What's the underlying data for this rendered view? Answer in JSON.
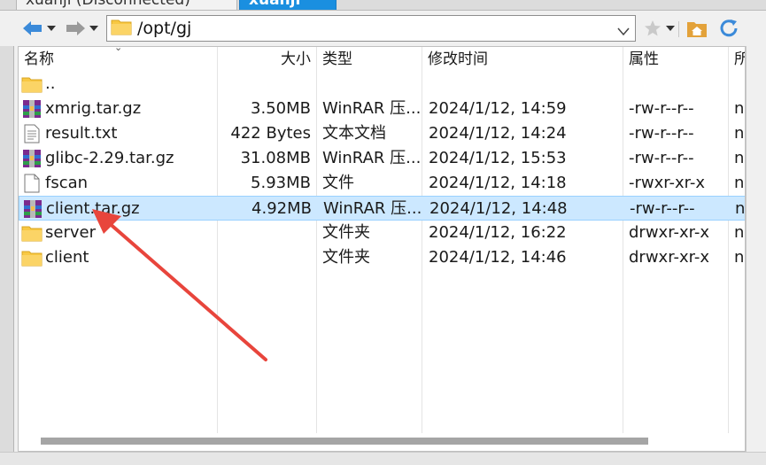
{
  "tabs": [
    {
      "label": "xuanji (Disconnected)",
      "active": false
    },
    {
      "label": "xuanji",
      "active": true
    }
  ],
  "toolbar": {
    "path": "/opt/gj"
  },
  "columns": {
    "name": "名称",
    "size": "大小",
    "type": "类型",
    "modified": "修改时间",
    "permissions": "属性",
    "owner": "所"
  },
  "files": [
    {
      "name": "..",
      "size": "",
      "type": "",
      "modified": "",
      "permissions": "",
      "owner": "",
      "icon": "folder-up-icon",
      "selected": false
    },
    {
      "name": "xmrig.tar.gz",
      "size": "3.50MB",
      "type": "WinRAR 压...",
      "modified": "2024/1/12, 14:59",
      "permissions": "-rw-r--r--",
      "owner": "n",
      "icon": "winrar-archive-icon",
      "selected": false
    },
    {
      "name": "result.txt",
      "size": "422 Bytes",
      "type": "文本文档",
      "modified": "2024/1/12, 14:24",
      "permissions": "-rw-r--r--",
      "owner": "n",
      "icon": "text-file-icon",
      "selected": false
    },
    {
      "name": "glibc-2.29.tar.gz",
      "size": "31.08MB",
      "type": "WinRAR 压...",
      "modified": "2024/1/12, 15:53",
      "permissions": "-rw-r--r--",
      "owner": "n",
      "icon": "winrar-archive-icon",
      "selected": false
    },
    {
      "name": "fscan",
      "size": "5.93MB",
      "type": "文件",
      "modified": "2024/1/12, 14:18",
      "permissions": "-rwxr-xr-x",
      "owner": "n",
      "icon": "blank-file-icon",
      "selected": false
    },
    {
      "name": "client.tar.gz",
      "size": "4.92MB",
      "type": "WinRAR 压...",
      "modified": "2024/1/12, 14:48",
      "permissions": "-rw-r--r--",
      "owner": "n",
      "icon": "winrar-archive-icon",
      "selected": true
    },
    {
      "name": "server",
      "size": "",
      "type": "文件夹",
      "modified": "2024/1/12, 16:22",
      "permissions": "drwxr-xr-x",
      "owner": "n",
      "icon": "folder-icon",
      "selected": false
    },
    {
      "name": "client",
      "size": "",
      "type": "文件夹",
      "modified": "2024/1/12, 14:46",
      "permissions": "drwxr-xr-x",
      "owner": "n",
      "icon": "folder-icon",
      "selected": false
    }
  ],
  "colors": {
    "selection": "#cce8ff",
    "selection_border": "#99d1ff",
    "active_tab": "#1a8fe0",
    "annotation_arrow": "#e8453c",
    "folder": "#f8c843"
  }
}
